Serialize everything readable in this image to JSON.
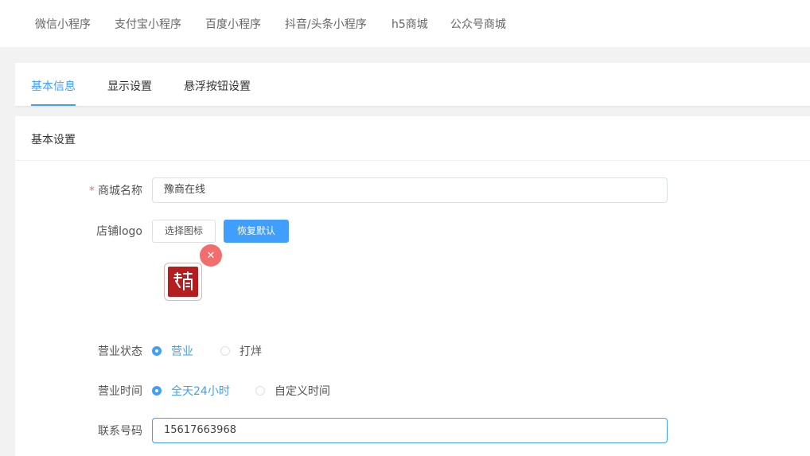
{
  "topnav": {
    "items": [
      "微信小程序",
      "支付宝小程序",
      "百度小程序",
      "抖音/头条小程序",
      "h5商城",
      "公众号商城"
    ]
  },
  "tabs": [
    "基本信息",
    "显示设置",
    "悬浮按钮设置"
  ],
  "section": {
    "title": "基本设置"
  },
  "form": {
    "shop_name": {
      "label": "商城名称",
      "required_mark": "*",
      "value": "豫商在线"
    },
    "logo": {
      "label": "店铺logo",
      "choose_label": "选择图标",
      "reset_label": "恢复默认",
      "remove_icon": "close-icon",
      "image_text": "豫商"
    },
    "business_status": {
      "label": "营业状态",
      "options": [
        "营业",
        "打烊"
      ],
      "selected": "营业"
    },
    "business_hours": {
      "label": "营业时间",
      "options": [
        "全天24小时",
        "自定义时间"
      ],
      "selected": "全天24小时"
    },
    "phone": {
      "label": "联系号码",
      "value": "15617663968"
    }
  },
  "colors": {
    "accent": "#409eff",
    "danger": "#f26d6d",
    "logo_red": "#b41e1e"
  }
}
